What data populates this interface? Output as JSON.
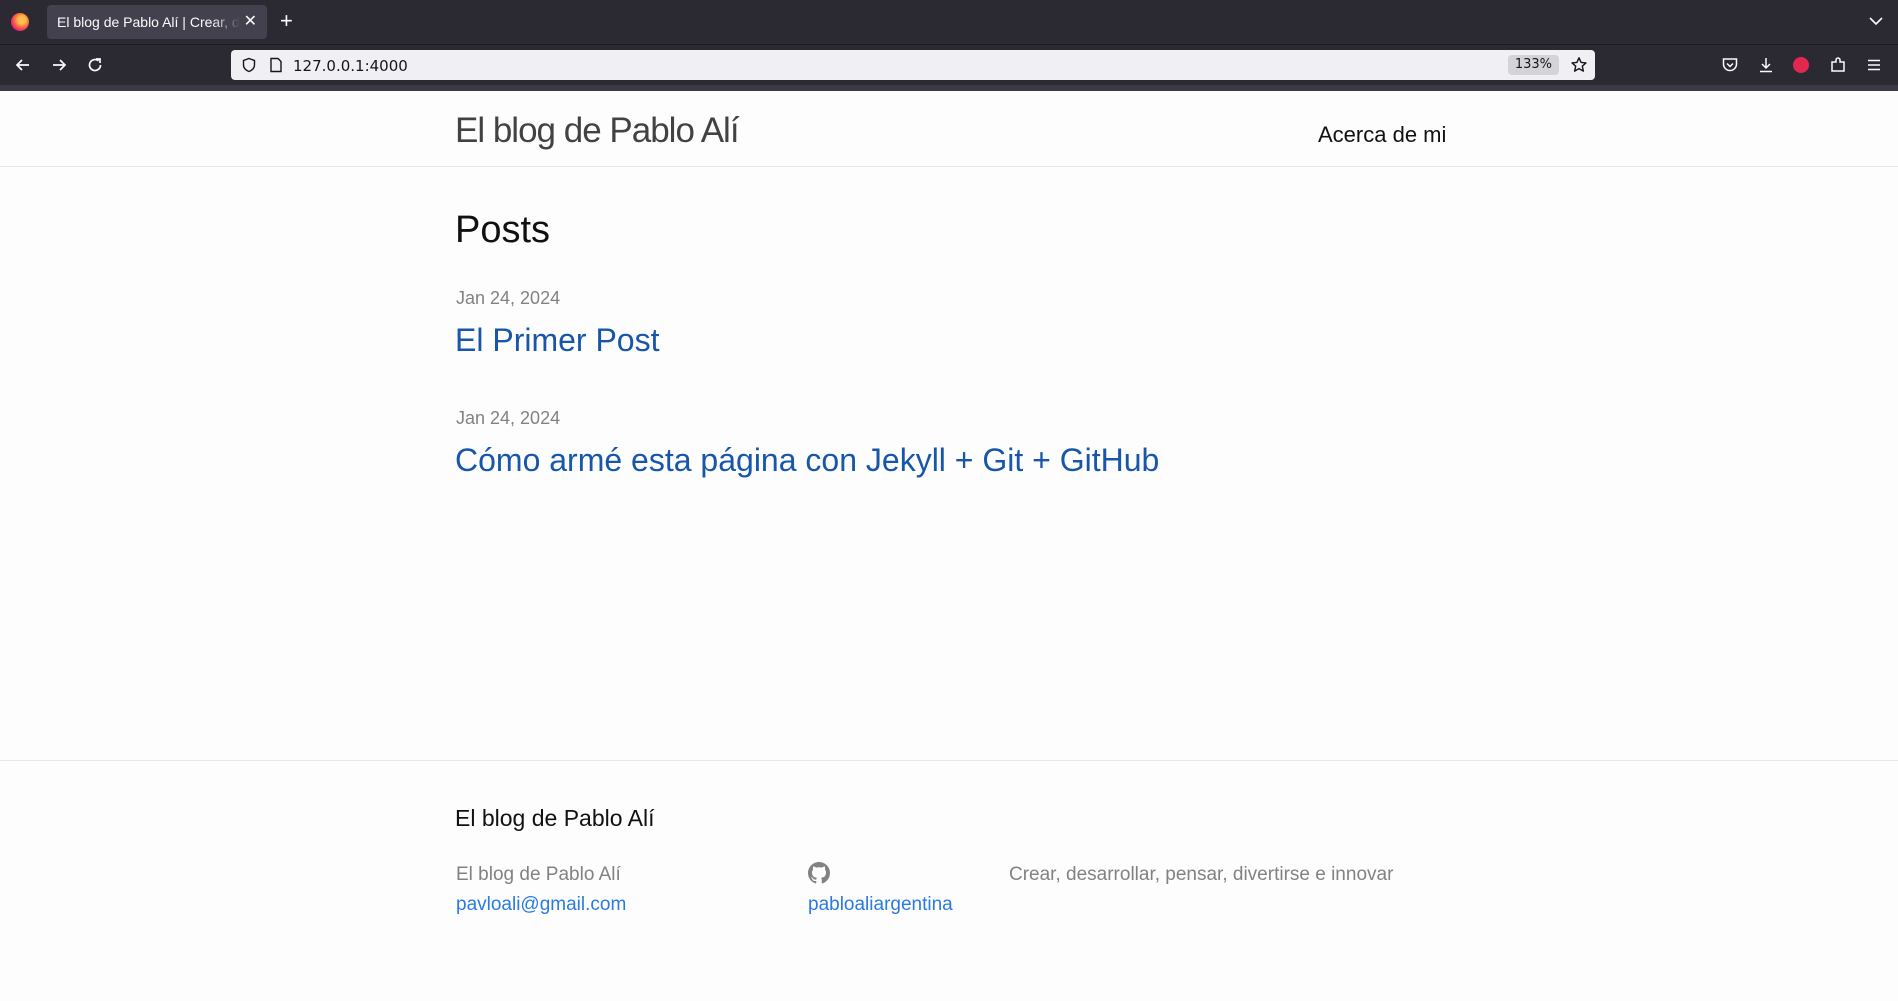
{
  "browser": {
    "tab_title": "El blog de Pablo Alí | Crear, desarrollar, pensar, divertirse e innovar",
    "new_tab": "+",
    "url": "127.0.0.1:4000",
    "zoom": "133%"
  },
  "site": {
    "title": "El blog de Pablo Alí",
    "nav": {
      "about": "Acerca de mi"
    }
  },
  "main": {
    "heading": "Posts",
    "posts": [
      {
        "date": "Jan 24, 2024",
        "title": "El Primer Post"
      },
      {
        "date": "Jan 24, 2024",
        "title": "Cómo armé esta página con Jekyll + Git + GitHub"
      }
    ]
  },
  "footer": {
    "heading": "El blog de Pablo Alí",
    "name": "El blog de Pablo Alí",
    "email": "pavloali@gmail.com",
    "github_user": "pabloaliargentina",
    "description": "Crear, desarrollar, pensar, divertirse e innovar"
  },
  "colors": {
    "link": "#2a7ae2",
    "visited_link": "#1756a9",
    "muted_text": "#828282",
    "chrome_bg": "#2b2a33"
  }
}
